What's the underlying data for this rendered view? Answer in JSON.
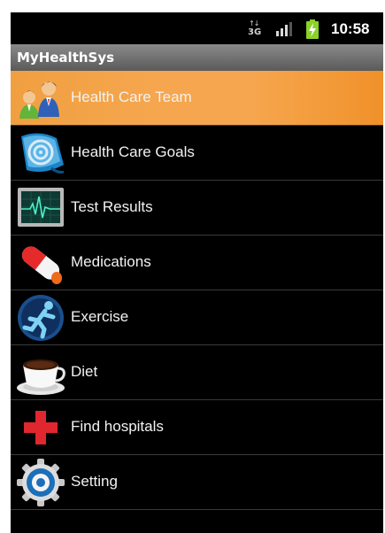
{
  "status_bar": {
    "network_type": "3G",
    "network_icon": "3g-data-icon",
    "signal_icon": "signal-strength-icon",
    "battery_icon": "battery-charging-icon",
    "time": "10:58"
  },
  "app": {
    "title": "MyHealthSys"
  },
  "menu": {
    "items": [
      {
        "label": "Health Care Team",
        "icon": "people-icon",
        "selected": true
      },
      {
        "label": "Health Care Goals",
        "icon": "goals-icon",
        "selected": false
      },
      {
        "label": "Test Results",
        "icon": "heart-monitor-icon",
        "selected": false
      },
      {
        "label": "Medications",
        "icon": "pill-capsule-icon",
        "selected": false
      },
      {
        "label": "Exercise",
        "icon": "running-person-icon",
        "selected": false
      },
      {
        "label": "Diet",
        "icon": "coffee-cup-icon",
        "selected": false
      },
      {
        "label": "Find hospitals",
        "icon": "red-cross-icon",
        "selected": false
      },
      {
        "label": "Setting",
        "icon": "gear-icon",
        "selected": false
      }
    ]
  },
  "colors": {
    "selected_row": "#f6a64e",
    "title_bar": "#707070",
    "background": "#000000",
    "text": "#f2f2f2"
  }
}
